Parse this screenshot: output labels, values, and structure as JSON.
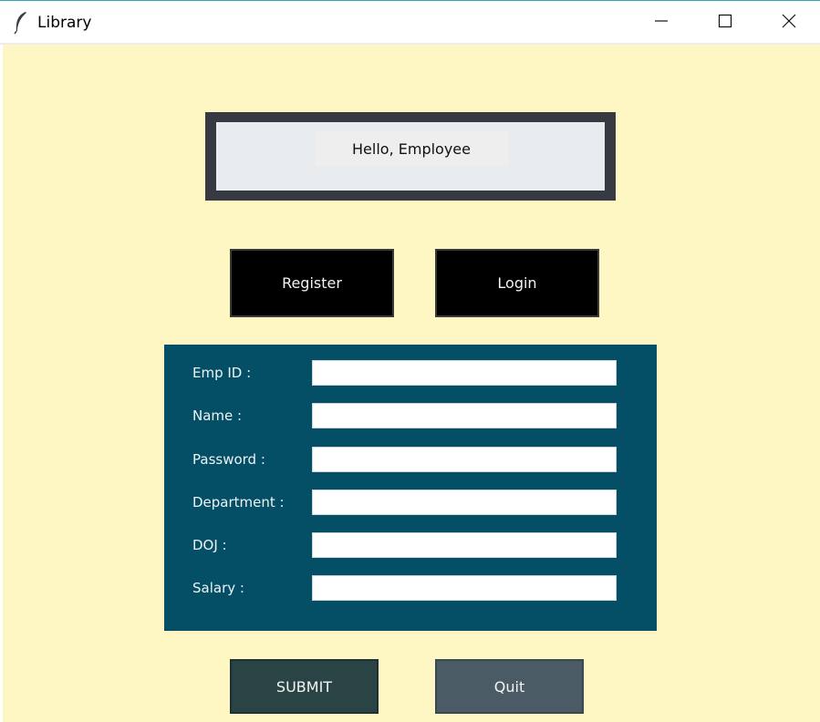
{
  "window": {
    "title": "Library",
    "icon": "feather-icon",
    "controls": [
      "minimize-icon",
      "maximize-icon",
      "close-icon"
    ]
  },
  "header": {
    "greeting": "Hello, Employee"
  },
  "auth_buttons": {
    "register_label": "Register",
    "login_label": "Login"
  },
  "form": {
    "fields": [
      {
        "label": "Emp ID :",
        "value": "",
        "placeholder": ""
      },
      {
        "label": "Name :",
        "value": "",
        "placeholder": ""
      },
      {
        "label": "Password :",
        "value": "",
        "placeholder": ""
      },
      {
        "label": "Department :",
        "value": "",
        "placeholder": ""
      },
      {
        "label": "DOJ :",
        "value": "",
        "placeholder": ""
      },
      {
        "label": "Salary :",
        "value": "",
        "placeholder": ""
      }
    ]
  },
  "actions": {
    "submit_label": "SUBMIT",
    "quit_label": "Quit"
  },
  "colors": {
    "background": "#fef7c4",
    "header_frame": "#373a42",
    "form_panel": "#044f66",
    "submit_button": "#2a4446",
    "quit_button": "#4a5b66",
    "auth_button": "#000000"
  }
}
